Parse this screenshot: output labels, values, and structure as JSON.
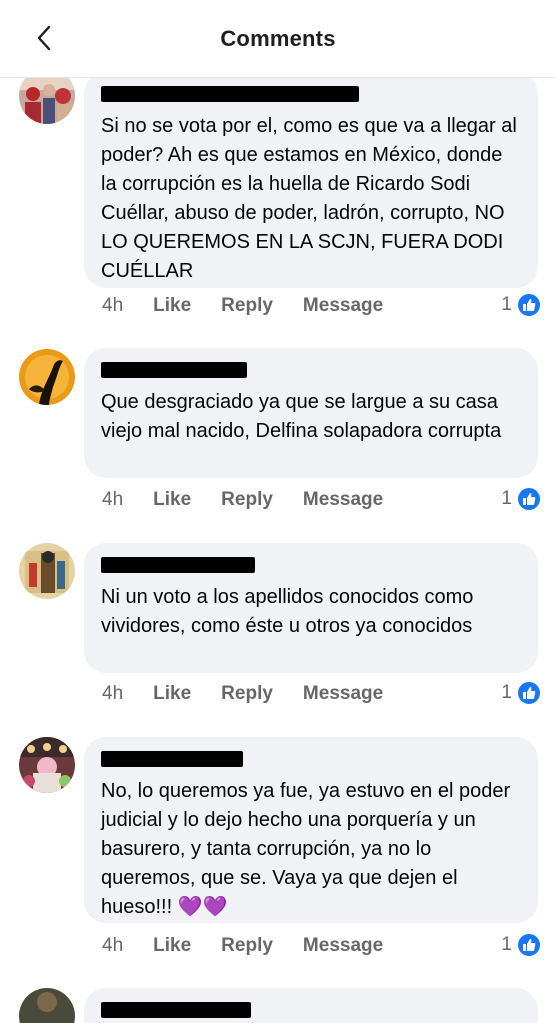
{
  "header": {
    "title": "Comments",
    "back_icon": "chevron-left-icon"
  },
  "colors": {
    "like_blue": "#1877f2",
    "bubble_bg": "#f0f2f5",
    "meta_text": "#65676b"
  },
  "actions": {
    "like": "Like",
    "reply": "Reply",
    "message": "Message"
  },
  "comments": [
    {
      "author_name_redacted": true,
      "text": "Si no se vota por el, como es que va a llegar al poder? Ah es que estamos en México, donde la corrupción es la huella de Ricardo Sodi Cuéllar, abuso de poder, ladrón, corrupto, NO LO QUEREMOS EN LA SCJN, FUERA DODI CUÉLLAR",
      "time": "4h",
      "reactions": "1"
    },
    {
      "author_name_redacted": true,
      "text": "Que desgraciado ya que se largue a su casa viejo mal nacido, Delfina solapadora corrupta",
      "time": "4h",
      "reactions": "1"
    },
    {
      "author_name_redacted": true,
      "text": "Ni un voto a los apellidos conocidos como vividores, como éste u otros ya conocidos",
      "time": "4h",
      "reactions": "1"
    },
    {
      "author_name_redacted": true,
      "text": "No, lo queremos ya fue, ya estuvo en el poder judicial y lo dejo hecho una porquería y un basurero, y tanta corrupción, ya no lo queremos, que se. Vaya ya que dejen el hueso!!!",
      "emoji": "💜💜",
      "time": "4h",
      "reactions": "1"
    }
  ]
}
